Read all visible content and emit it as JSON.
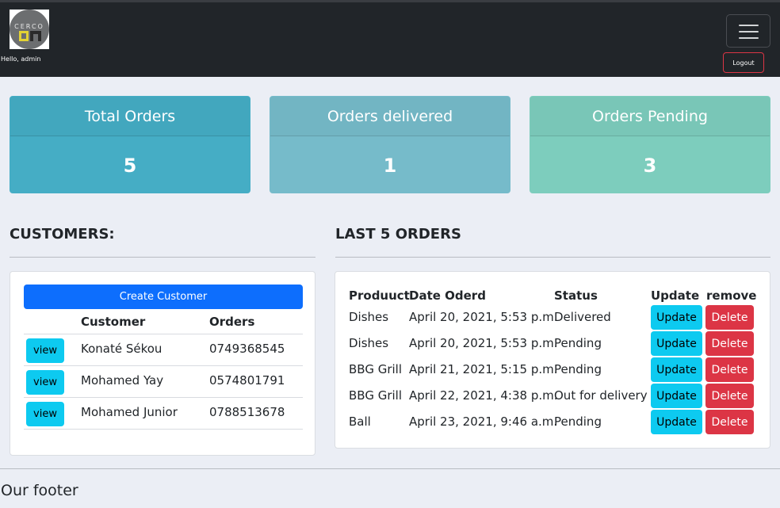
{
  "header": {
    "greeting": "Hello, admin",
    "logout_label": "Logout",
    "logo_text": "CERCO IA",
    "menu_icon": "hamburger-icon"
  },
  "stats": [
    {
      "title": "Total Orders",
      "value": "5",
      "color": "#45adc5"
    },
    {
      "title": "Orders delivered",
      "value": "1",
      "color": "#76bbca"
    },
    {
      "title": "Orders Pending",
      "value": "3",
      "color": "#7dcdbd"
    }
  ],
  "customers": {
    "title": "CUSTOMERS:",
    "create_label": "Create Customer",
    "headers": [
      "",
      "Customer",
      "Orders"
    ],
    "view_label": "view",
    "rows": [
      {
        "name": "Konaté Sékou",
        "phone": "0749368545"
      },
      {
        "name": "Mohamed Yay",
        "phone": "0574801791"
      },
      {
        "name": "Mohamed Junior",
        "phone": "0788513678"
      }
    ]
  },
  "orders": {
    "title": "LAST 5 ORDERS",
    "headers": [
      "Produuct",
      "Date Oderd",
      "Status",
      "Update",
      "remove"
    ],
    "update_label": "Update",
    "delete_label": "Delete",
    "rows": [
      {
        "product": "Dishes",
        "date": "April 20, 2021, 5:53 p.m.",
        "status": "Delivered"
      },
      {
        "product": "Dishes",
        "date": "April 20, 2021, 5:53 p.m.",
        "status": "Pending"
      },
      {
        "product": "BBG Grill",
        "date": "April 21, 2021, 5:15 p.m.",
        "status": "Pending"
      },
      {
        "product": "BBG Grill",
        "date": "April 22, 2021, 4:38 p.m.",
        "status": "Out for delivery"
      },
      {
        "product": "Ball",
        "date": "April 23, 2021, 9:46 a.m.",
        "status": "Pending"
      }
    ]
  },
  "footer": {
    "text": "Our footer"
  }
}
